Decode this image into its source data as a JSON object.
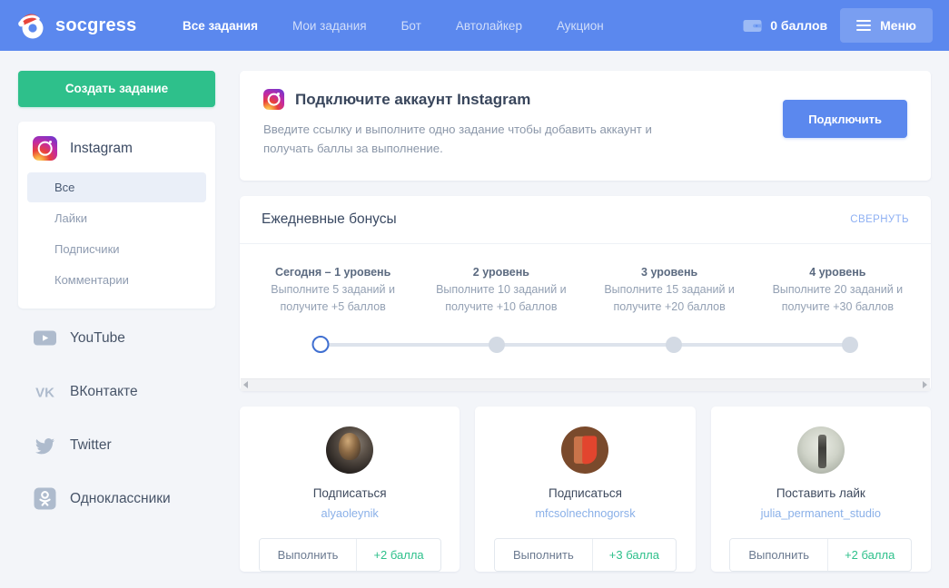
{
  "header": {
    "brand": "socgress",
    "logo_icon": "socgress-santa-logo",
    "nav": [
      {
        "label": "Все задания",
        "active": true
      },
      {
        "label": "Мои задания",
        "active": false
      },
      {
        "label": "Бот",
        "active": false
      },
      {
        "label": "Автолайкер",
        "active": false
      },
      {
        "label": "Аукцион",
        "active": false
      }
    ],
    "points": "0 баллов",
    "points_icon": "wallet-icon",
    "menu_label": "Меню",
    "menu_icon": "hamburger-icon",
    "bg_color": "#5b88ee"
  },
  "sidebar": {
    "create_button": "Создать задание",
    "create_button_color": "#2ec08b",
    "instagram": {
      "name": "Instagram",
      "icon": "instagram-icon",
      "items": [
        {
          "label": "Все",
          "active": true
        },
        {
          "label": "Лайки",
          "active": false
        },
        {
          "label": "Подписчики",
          "active": false
        },
        {
          "label": "Комментарии",
          "active": false
        }
      ]
    },
    "networks": [
      {
        "label": "YouTube",
        "icon": "youtube-icon"
      },
      {
        "label": "ВКонтакте",
        "icon": "vk-icon"
      },
      {
        "label": "Twitter",
        "icon": "twitter-icon"
      },
      {
        "label": "Одноклассники",
        "icon": "odnoklassniki-icon"
      }
    ]
  },
  "connect_card": {
    "icon": "instagram-icon",
    "title": "Подключите аккаунт Instagram",
    "description": "Введите ссылку и выполните одно задание чтобы добавить аккаунт и получать баллы за выполнение.",
    "button": "Подключить",
    "button_color": "#5b88ee"
  },
  "bonuses": {
    "title": "Ежедневные бонусы",
    "collapse_label": "СВЕРНУТЬ",
    "levels": [
      {
        "title": "Сегодня – 1 уровень",
        "desc": "Выполните 5 заданий и получите +5 баллов",
        "active": true
      },
      {
        "title": "2 уровень",
        "desc": "Выполните 10 заданий и получите +10 баллов",
        "active": false
      },
      {
        "title": "3 уровень",
        "desc": "Выполните 15 заданий и получите +20 баллов",
        "active": false
      },
      {
        "title": "4 уровень",
        "desc": "Выполните 20 заданий и получите +30 баллов",
        "active": false
      }
    ],
    "active_color": "#3f6fd1",
    "inactive_color": "#d3dae4"
  },
  "tasks": [
    {
      "action": "Подписаться",
      "user": "alyaoleynik",
      "button": "Выполнить",
      "points": "+2 балла",
      "avatar": "avatar-woman-photo"
    },
    {
      "action": "Подписаться",
      "user": "mfcsolnechnogorsk",
      "button": "Выполнить",
      "points": "+3 балла",
      "avatar": "avatar-mfc-logo"
    },
    {
      "action": "Поставить лайк",
      "user": "julia_permanent_studio",
      "button": "Выполнить",
      "points": "+2 балла",
      "avatar": "avatar-studio-photo"
    }
  ]
}
